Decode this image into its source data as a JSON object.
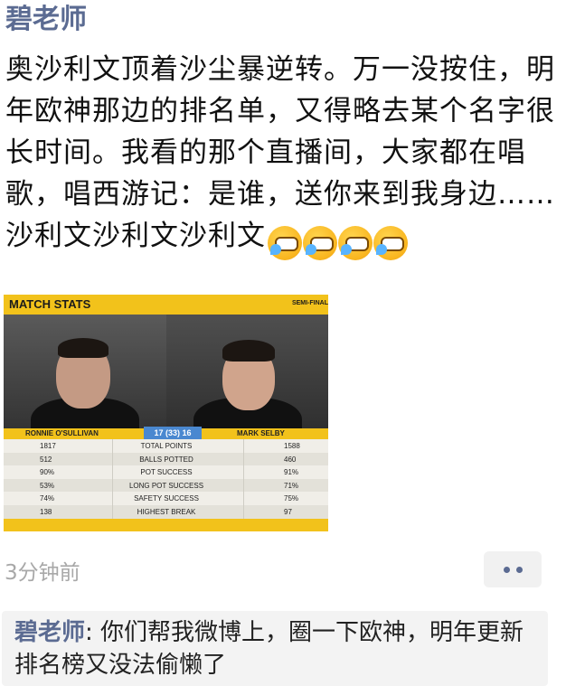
{
  "post": {
    "author": "碧老师",
    "text": "奥沙利文顶着沙尘暴逆转。万一没按住，明年欧神那边的排名单，又得略去某个名字很长时间。我看的那个直播间，大家都在唱歌，唱西游记：是谁，送你来到我身边……沙利文沙利文沙利文",
    "emojis": [
      "crying-laughing-face-icon",
      "crying-laughing-face-icon",
      "crying-laughing-face-icon",
      "crying-laughing-face-icon"
    ],
    "time": "3分钟前"
  },
  "stats_image": {
    "title": "MATCH STATS",
    "round": "SEMI-FINAL",
    "player_left": "RONNIE O'SULLIVAN",
    "player_right": "MARK SELBY",
    "score": "17 (33) 16",
    "rows": [
      {
        "left": "1817",
        "label": "TOTAL POINTS",
        "right": "1588"
      },
      {
        "left": "512",
        "label": "BALLS POTTED",
        "right": "460"
      },
      {
        "left": "90%",
        "label": "POT SUCCESS",
        "right": "91%"
      },
      {
        "left": "53%",
        "label": "LONG POT SUCCESS",
        "right": "71%"
      },
      {
        "left": "74%",
        "label": "SAFETY SUCCESS",
        "right": "75%"
      },
      {
        "left": "138",
        "label": "HIGHEST BREAK",
        "right": "97"
      }
    ],
    "colors": {
      "accent": "#f2c21b",
      "score_bg": "#4a88d0"
    }
  },
  "comment": {
    "author": "碧老师",
    "separator": ": ",
    "text": "你们帮我微博上，圈一下欧神，明年更新排名榜又没法偷懒了"
  },
  "colors": {
    "author": "#5b6b92",
    "time": "#a8a8a8"
  }
}
